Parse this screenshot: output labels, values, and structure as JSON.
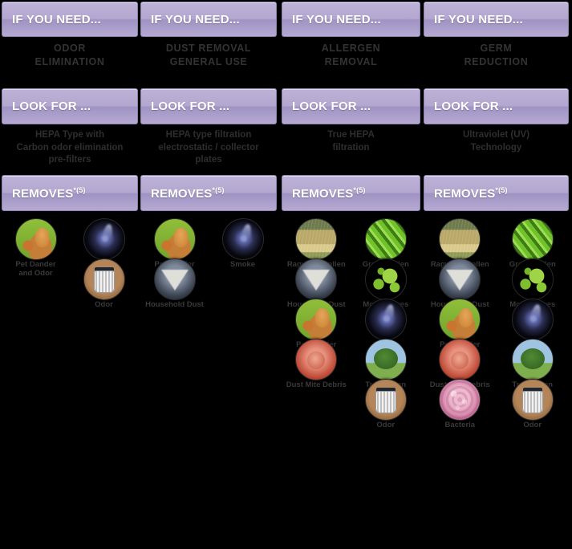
{
  "theme": {
    "background": "#000000",
    "panel_gradient_top": "#bdb2d6",
    "panel_gradient_bottom": "#b5a9d2",
    "panel_border": "#8d80b0",
    "panel_text": "#ffffff",
    "caption_text": "#333333"
  },
  "row_labels": {
    "need": "IF YOU NEED...",
    "look": "LOOK FOR ...",
    "removes": "REMOVES",
    "removes_superscript": "*(5)"
  },
  "columns": [
    {
      "need_caption": "ODOR\nELIMINATION",
      "look_caption": "HEPA Type with\nCarbon odor elimination\npre-filters",
      "removes": [
        {
          "label": "Pet Dander\nand Odor",
          "icon": "pet-dander-icon"
        },
        {
          "label": "Smoke",
          "icon": "smoke-icon"
        },
        {
          "label": "",
          "icon": ""
        },
        {
          "label": "Odor",
          "icon": "odor-trashcan-icon"
        }
      ]
    },
    {
      "need_caption": "DUST REMOVAL\nGENERAL USE",
      "look_caption": "HEPA type filtration\nelectrostatic / collector\nplates",
      "removes": [
        {
          "label": "Pet Dander\nand Odor",
          "icon": "pet-dander-icon"
        },
        {
          "label": "Smoke",
          "icon": "smoke-icon"
        },
        {
          "label": "Household Dust",
          "icon": "household-dust-icon"
        },
        {
          "label": "",
          "icon": ""
        }
      ]
    },
    {
      "need_caption": "ALLERGEN\nREMOVAL",
      "look_caption": "True HEPA\nfiltration",
      "removes": [
        {
          "label": "Ragweed Pollen",
          "icon": "ragweed-pollen-icon"
        },
        {
          "label": "Grass Pollen",
          "icon": "grass-pollen-icon"
        },
        {
          "label": "Household Dust",
          "icon": "household-dust-icon"
        },
        {
          "label": "Mold Spores",
          "icon": "mold-spores-icon"
        },
        {
          "label": "Pet Dander\nand Odor",
          "icon": "pet-dander-icon"
        },
        {
          "label": "Smoke",
          "icon": "smoke-icon"
        },
        {
          "label": "Dust Mite Debris",
          "icon": "dust-mite-icon"
        },
        {
          "label": "Tree Pollen",
          "icon": "tree-pollen-icon"
        },
        {
          "label": "",
          "icon": ""
        },
        {
          "label": "Odor",
          "icon": "odor-trashcan-icon"
        }
      ]
    },
    {
      "need_caption": "GERM\nREDUCTION",
      "look_caption": "Ultraviolet (UV)\nTechnology",
      "removes": [
        {
          "label": "Ragweed Pollen",
          "icon": "ragweed-pollen-icon"
        },
        {
          "label": "Grass Pollen",
          "icon": "grass-pollen-icon"
        },
        {
          "label": "Household Dust",
          "icon": "household-dust-icon"
        },
        {
          "label": "Mold Spores",
          "icon": "mold-spores-icon"
        },
        {
          "label": "Pet Dander\nand Odor",
          "icon": "pet-dander-icon"
        },
        {
          "label": "Smoke",
          "icon": "smoke-icon"
        },
        {
          "label": "Dust Mite Debris",
          "icon": "dust-mite-icon"
        },
        {
          "label": "Tree Pollen",
          "icon": "tree-pollen-icon"
        },
        {
          "label": "Bacteria",
          "icon": "bacteria-icon"
        },
        {
          "label": "Odor",
          "icon": "odor-trashcan-icon"
        }
      ]
    }
  ]
}
